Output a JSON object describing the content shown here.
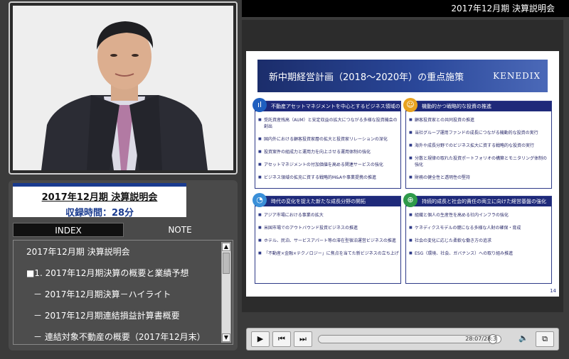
{
  "window": {
    "title": "2017年12月期 決算説明会"
  },
  "info": {
    "title": "2017年12月期 決算説明会",
    "duration": "収録時間：28分"
  },
  "tabs": {
    "index": "INDEX",
    "note": "NOTE"
  },
  "index_items": [
    "2017年12月期 決算説明会",
    "■1. 2017年12月期決算の概要と業績予想",
    "－ 2017年12月期決算－ハイライト",
    "－ 2017年12月期連結損益計算書概要",
    "－ 連結対象不動産の概要（2017年12月末）"
  ],
  "slide": {
    "title": "新中期経営計画（2018～2020年）の重点施策",
    "logo": "KENEDIX",
    "page": "14",
    "quads": [
      {
        "icon": "ıl",
        "icon_name": "bar-chart-icon",
        "color": "#1f5fbf",
        "heading": "不動産アセットマネジメントを中心とするビジネス領域の拡充",
        "items": [
          "受託資産残高（AUM）と安定収益の拡大につながる多様な投資機会の創出",
          "国内外における顧客投資家層の拡大と投資家リレーションの深化",
          "投資案件の組成力と運用力を向上させる運用体制の強化",
          "アセットマネジメントの付加価値を高める関連サービスの強化",
          "ビジネス領域の拡充に資する戦略的M&Aや事業提携の推進"
        ]
      },
      {
        "icon": "☺",
        "icon_name": "person-icon",
        "color": "#e8a21f",
        "heading": "機動的かつ戦略的な投資の推進",
        "items": [
          "顧客投資家との共同投資の推進",
          "当社グループ運用ファンドの成長につながる機動的な投資の実行",
          "海外や成長分野でのビジネス拡大に資する戦略的な投資の実行",
          "分散と規律の取れた投資ポートフォリオの構築とモニタリング体制の強化",
          "財務の健全性と透明性の堅持"
        ]
      },
      {
        "icon": "◔",
        "icon_name": "growth-icon",
        "color": "#3a8fd8",
        "heading": "時代の変化を捉えた新たな成長分野の開拓",
        "items": [
          "アジア市場における事業の拡大",
          "米国市場でのアウトバウンド投資ビジネスの推進",
          "ホテル、民泊、サービスアパート等の滞在型宿泊運営ビジネスの推進",
          "「不動産×金融×テクノロジー」に焦点を当てた新ビジネスの立ち上げ"
        ]
      },
      {
        "icon": "⊕",
        "icon_name": "globe-icon",
        "color": "#2f9a4a",
        "heading": "持続的成長と社会的責任の両立に向けた経営基盤の強化",
        "items": [
          "組織と個人の生産性を高める社内インフラの強化",
          "ケネディクスモデルの礎になる多様な人財の確保・育成",
          "社会の変化に応じた柔軟な働き方の追求",
          "ESG（環境、社会、ガバナンス）への取り組み推進"
        ]
      }
    ]
  },
  "player": {
    "time": "28:07/28:3",
    "progress": 0.98,
    "play_icon": "play-icon",
    "prev_icon": "skip-back-icon",
    "next_icon": "skip-forward-icon",
    "volume_icon": "volume-icon",
    "popout_icon": "popout-icon"
  }
}
